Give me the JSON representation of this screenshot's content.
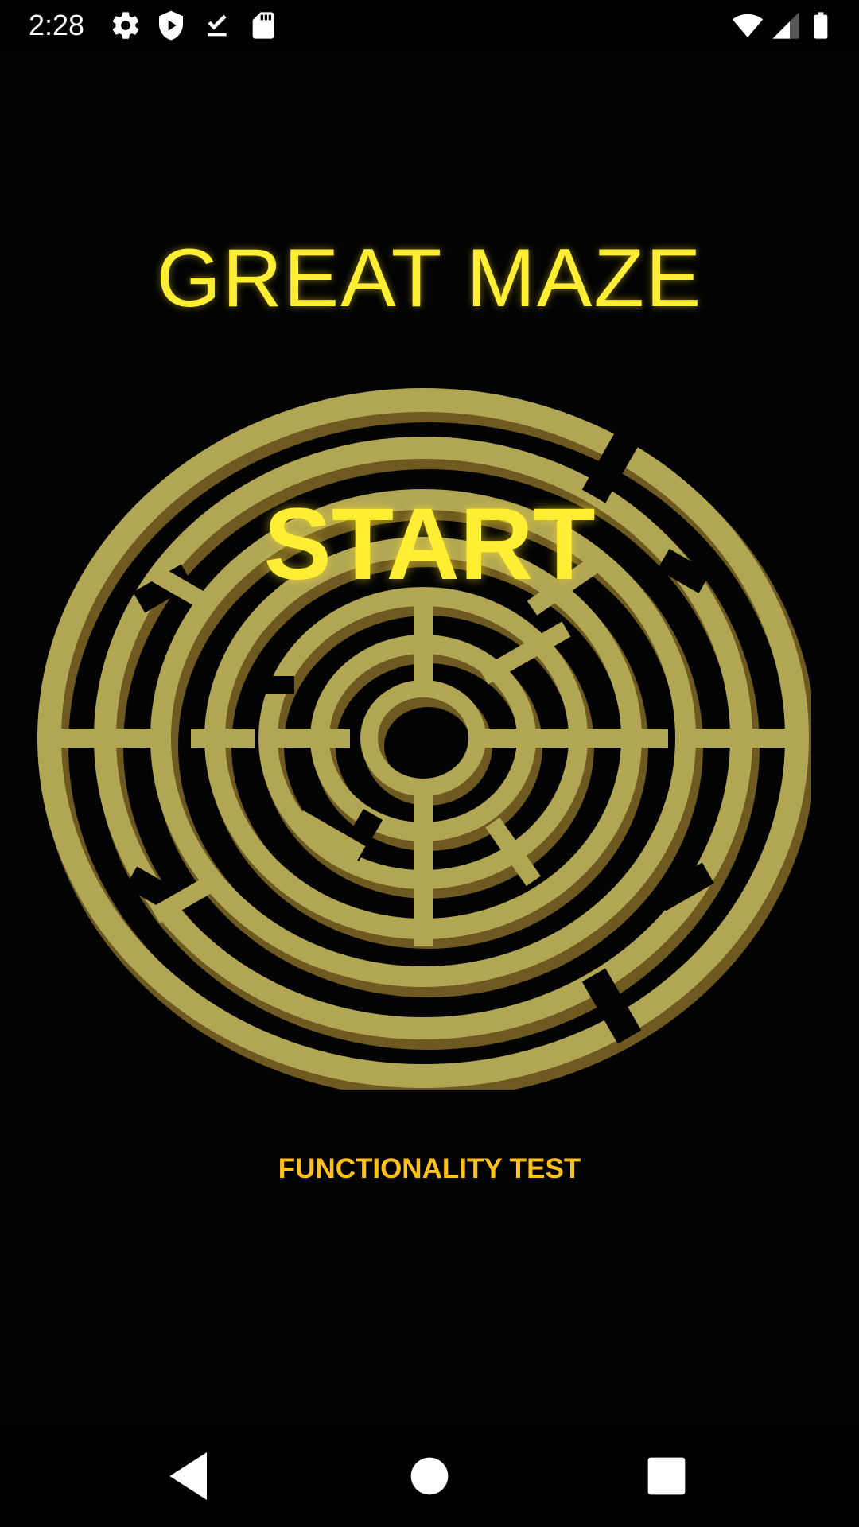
{
  "status_bar": {
    "time": "2:28",
    "left_icons": [
      "settings-icon",
      "shield-play-icon",
      "download-done-icon",
      "sd-card-icon"
    ],
    "right_icons": [
      "wifi-icon",
      "cell-signal-icon",
      "battery-icon"
    ]
  },
  "app": {
    "title": "GREAT MAZE",
    "start_label": "START",
    "functionality_test_label": "FUNCTIONALITY TEST",
    "maze_image": "circular-maze-illustration"
  },
  "nav_bar": {
    "buttons": [
      "back-icon",
      "home-icon",
      "recents-icon"
    ]
  },
  "colors": {
    "background": "#030303",
    "title": "#ffee33",
    "start": "#ffee33",
    "functionality_test": "#ffc21c",
    "maze_light": "#b0a654",
    "maze_dark": "#6e5a20"
  }
}
